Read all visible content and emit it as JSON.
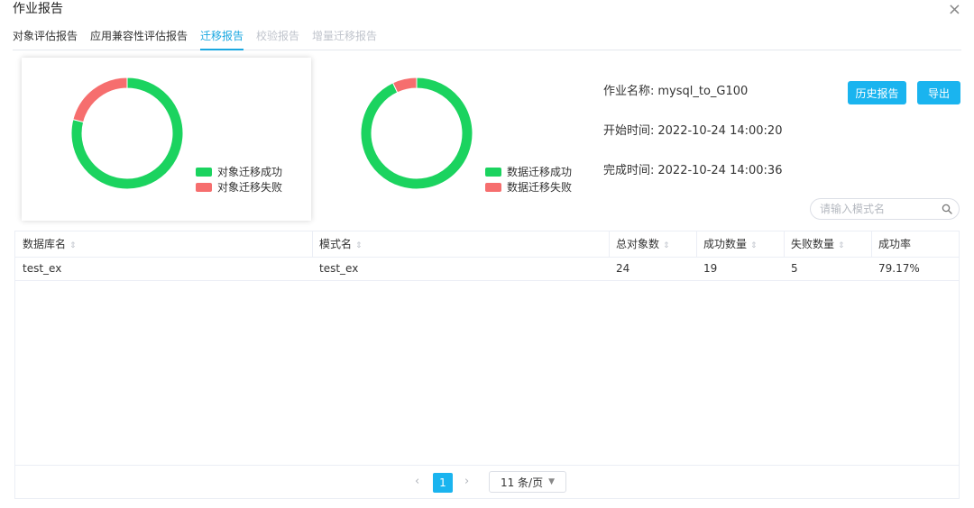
{
  "dialog": {
    "title": "作业报告",
    "close_icon": "×"
  },
  "tabs": [
    {
      "label": "对象评估报告",
      "state": "normal"
    },
    {
      "label": "应用兼容性评估报告",
      "state": "normal"
    },
    {
      "label": "迁移报告",
      "state": "active"
    },
    {
      "label": "校验报告",
      "state": "disabled"
    },
    {
      "label": "增量迁移报告",
      "state": "disabled"
    }
  ],
  "charts": {
    "object_migration": {
      "legend": [
        {
          "label": "对象迁移成功",
          "color": "#1bd35f"
        },
        {
          "label": "对象迁移失败",
          "color": "#f66e6e"
        }
      ],
      "fractions": [
        0.79,
        0.21
      ]
    },
    "data_migration": {
      "legend": [
        {
          "label": "数据迁移成功",
          "color": "#1bd35f"
        },
        {
          "label": "数据迁移失败",
          "color": "#f66e6e"
        }
      ],
      "fractions": [
        0.93,
        0.07
      ]
    }
  },
  "job_info": {
    "name_label": "作业名称:",
    "name_value": "mysql_to_G100",
    "start_label": "开始时间:",
    "start_value": "2022-10-24 14:00:20",
    "end_label": "完成时间:",
    "end_value": "2022-10-24 14:00:36"
  },
  "buttons": {
    "history": "历史报告",
    "export": "导出"
  },
  "search": {
    "placeholder": "请输入模式名",
    "value": "",
    "icon": "search-icon"
  },
  "table": {
    "headers": [
      "数据库名",
      "模式名",
      "总对象数",
      "成功数量",
      "失败数量",
      "成功率"
    ],
    "sortable": [
      true,
      true,
      true,
      true,
      true,
      false
    ],
    "rows": [
      [
        "test_ex",
        "test_ex",
        "24",
        "19",
        "5",
        "79.17%"
      ]
    ]
  },
  "pagination": {
    "prev_icon": "‹",
    "next_icon": "›",
    "current_page": "1",
    "page_size_label": "11 条/页"
  },
  "colors": {
    "accent": "#1ab4ef",
    "success": "#1bd35f",
    "fail": "#f66e6e"
  }
}
